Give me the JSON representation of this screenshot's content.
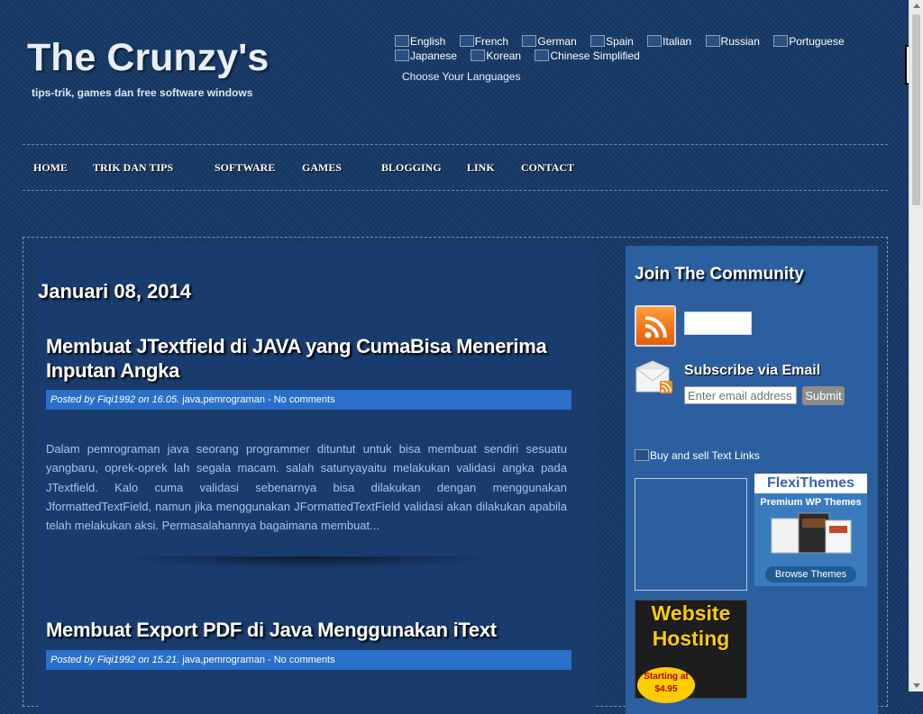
{
  "header": {
    "title": "The Crunzy's",
    "description": "tips-trik, games dan free software windows"
  },
  "languages": {
    "items": [
      "English",
      "French",
      "German",
      "Spain",
      "Italian",
      "Russian",
      "Portuguese",
      "Japanese",
      "Korean",
      "Chinese Simplified"
    ],
    "choose_label": "Choose Your Languages"
  },
  "nav": {
    "items": [
      "HOME",
      "TRIK DAN TIPS",
      "SOFTWARE",
      "GAMES",
      "BLOGGING",
      "LINK",
      "CONTACT"
    ]
  },
  "main": {
    "date_header": "Januari 08, 2014",
    "posts": [
      {
        "title": "Membuat JTextfield di JAVA yang CumaBisa Menerima Inputan Angka",
        "posted_by_label": "Posted by",
        "author": "Fiqi1992",
        "on_label": "on",
        "time": "16.05.",
        "labels": "java,pemrograman",
        "comments": "No comments",
        "excerpt": "Dalam pemrograman java seorang programmer dituntut untuk bisa membuat sendiri sesuatu yangbaru, oprek-oprek lah segala macam. salah satunyayaitu melakukan validasi angka pada JTextfield. Kalo cuma validasi sebenarnya bisa dilakukan dengan menggunakan JformattedTextField, namun jika menggunakan JFormattedTextField validasi akan dilakukan apabila telah melakukan aksi. Permasalahannya bagaimana membuat..."
      },
      {
        "title": "Membuat Export PDF di Java Menggunakan iText",
        "posted_by_label": "Posted by",
        "author": "Fiqi1992",
        "on_label": "on",
        "time": "15.21.",
        "labels": "java,pemrograman",
        "comments": "No comments"
      }
    ]
  },
  "sidebar": {
    "community_title": "Join The Community",
    "subscribe_title": "Subscribe via Email",
    "email_placeholder": "Enter email address",
    "submit_label": "Submit",
    "textlinks": "Buy and sell Text Links",
    "ad_flexi": {
      "brand": "FlexiThemes",
      "tagline": "Premium WP Themes",
      "cta": "Browse Themes"
    },
    "ad_hosting": {
      "line1": "Website",
      "line2": "Hosting",
      "price": "Starting at $4.95"
    }
  },
  "colors": {
    "background": "#163866",
    "main_panel": "#1a3b6e",
    "sidebar_panel": "#2c5f9f",
    "meta_bar": "#2a6fc9",
    "excerpt_text": "#a9c4e6"
  }
}
